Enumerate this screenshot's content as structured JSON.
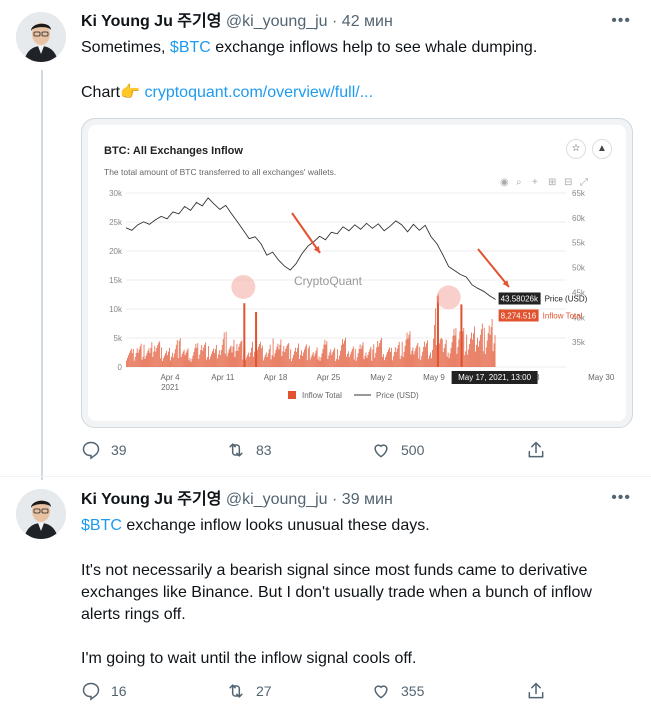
{
  "colors": {
    "link": "#1d9bf0",
    "text": "#0f1419",
    "muted": "#536471",
    "inflow": "#e1522f",
    "price": "#333333"
  },
  "tweets": [
    {
      "name": "Ki Young Ju 주기영",
      "handle": "@ki_young_ju",
      "dot": "·",
      "time": "42 мин",
      "text_before": "Sometimes, ",
      "cashtag": "$BTC",
      "text_after": " exchange inflows help to see whale dumping.",
      "chart_prefix": "Chart👉 ",
      "chart_link": "cryptoquant.com/overview/full/...",
      "replies": "39",
      "retweets": "83",
      "likes": "500"
    },
    {
      "name": "Ki Young Ju 주기영",
      "handle": "@ki_young_ju",
      "dot": "·",
      "time": "39 мин",
      "cashtag": "$BTC",
      "line1_rest": " exchange inflow looks unusual these days.",
      "para2": "It's not necessarily a bearish signal since most funds came to derivative exchanges like Binance. But I don't usually trade when a bunch of inflow alerts rings off.",
      "para3": "I'm going to wait until the inflow signal cools off.",
      "replies": "16",
      "retweets": "27",
      "likes": "355"
    }
  ],
  "chart_data": {
    "type": "line",
    "title": "BTC: All Exchanges Inflow",
    "subtitle": "The total amount of BTC transferred to all exchanges' wallets.",
    "watermark": "CryptoQuant",
    "x_ticks": [
      "Apr 4\n2021",
      "Apr 11",
      "Apr 18",
      "Apr 25",
      "May 2",
      "May 9",
      "May 16",
      "23",
      "May 30"
    ],
    "left_axis_ticks": [
      "30k",
      "25k",
      "20k",
      "15k",
      "10k",
      "5k",
      "0"
    ],
    "left_ylim": [
      0,
      30000
    ],
    "right_axis_ticks": [
      "65k",
      "60k",
      "55k",
      "50k",
      "45k",
      "40k",
      "35k"
    ],
    "right_ylim": [
      30000,
      65000
    ],
    "series": [
      {
        "name": "Inflow Total",
        "kind": "bar",
        "color": "#e1522f",
        "last_value": "8,274.516"
      },
      {
        "name": "Price (USD)",
        "kind": "line",
        "color": "#333333",
        "last_value": "43.58026k"
      }
    ],
    "legend": [
      "Inflow Total",
      "Price (USD)"
    ],
    "tooltip_date": "May 17, 2021, 13:00",
    "price_points": [
      58000,
      57500,
      58600,
      59200,
      58700,
      59600,
      60300,
      59800,
      61200,
      60800,
      62300,
      61500,
      63100,
      62400,
      64000,
      62800,
      61700,
      62500,
      60800,
      59200,
      57500,
      55800,
      56200,
      54800,
      52500,
      53100,
      51500,
      50300,
      49500,
      50800,
      52800,
      54300,
      55200,
      56300,
      55600,
      57100,
      56800,
      58200,
      57400,
      58600,
      57700,
      58900,
      57900,
      58800,
      57400,
      58300,
      59400,
      58600,
      57200,
      58700,
      57500,
      58500,
      56200,
      54800,
      52600,
      50200,
      49400,
      48600,
      48100,
      46500,
      45800,
      45200,
      44300,
      43580
    ],
    "inflow_points": [
      3200,
      2600,
      4100,
      3300,
      2900,
      5200,
      3100,
      2700,
      3800,
      4500,
      3000,
      2500,
      3600,
      4700,
      3100,
      2900,
      4000,
      5600,
      3300,
      6400,
      3100,
      2600,
      4800,
      3500,
      2900,
      4200,
      3600,
      5000,
      2800,
      3400,
      4400,
      3200,
      2700,
      3100,
      4200,
      3500,
      2600,
      4800,
      3300,
      2900,
      4100,
      3600,
      3000,
      5200,
      3400,
      2800,
      4300,
      3700,
      5800,
      4200,
      3200,
      4600,
      3500,
      12200,
      3800,
      4300,
      5900,
      7600,
      4800,
      5600,
      6800,
      6200,
      7300,
      8275
    ],
    "spike_points": [
      {
        "index": 20,
        "value": 11000
      },
      {
        "index": 22,
        "value": 9500
      },
      {
        "index": 53,
        "value": 12200
      },
      {
        "index": 57,
        "value": 10800
      }
    ]
  }
}
